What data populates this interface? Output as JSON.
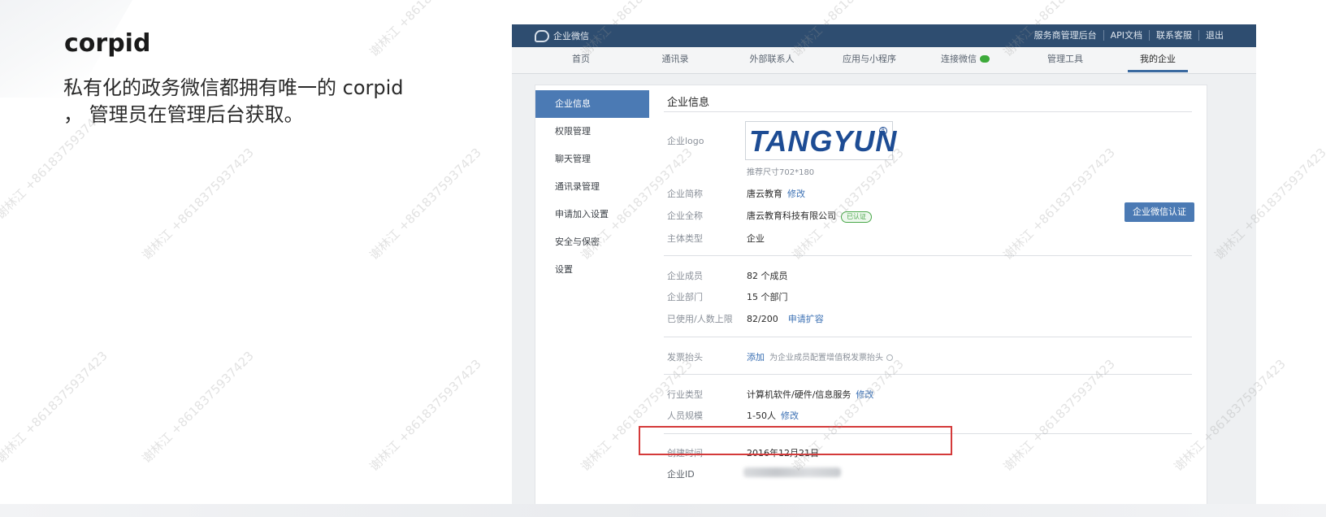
{
  "slide": {
    "title": "corpid",
    "description": "私有化的政务微信都拥有唯一的 corpid ， 管理员在管理后台获取。"
  },
  "screenshot": {
    "brand": "企业微信",
    "top_links": [
      "服务商管理后台",
      "API文档",
      "联系客服",
      "退出"
    ],
    "nav": [
      {
        "label": "首页",
        "active": false
      },
      {
        "label": "通讯录",
        "active": false
      },
      {
        "label": "外部联系人",
        "active": false
      },
      {
        "label": "应用与小程序",
        "active": false
      },
      {
        "label": "连接微信",
        "active": false
      },
      {
        "label": "管理工具",
        "active": false
      },
      {
        "label": "我的企业",
        "active": true
      }
    ],
    "sidebar": [
      {
        "label": "企业信息",
        "active": true
      },
      {
        "label": "权限管理",
        "active": false
      },
      {
        "label": "聊天管理",
        "active": false
      },
      {
        "label": "通讯录管理",
        "active": false
      },
      {
        "label": "申请加入设置",
        "active": false
      },
      {
        "label": "安全与保密",
        "active": false
      },
      {
        "label": "设置",
        "active": false
      }
    ],
    "content": {
      "title": "企业信息",
      "logo_label": "企业logo",
      "logo_text": "TANGYUN",
      "logo_hint": "推荐尺寸702*180",
      "short_name_label": "企业简称",
      "short_name": "唐云教育",
      "full_name_label": "企业全称",
      "full_name": "唐云教育科技有限公司",
      "verified": "已认证",
      "entity_type_label": "主体类型",
      "entity_type": "企业",
      "cert_button": "企业微信认证",
      "members_label": "企业成员",
      "members": "82 个成员",
      "departments_label": "企业部门",
      "departments": "15 个部门",
      "usage_label": "已使用/人数上限",
      "usage": "82/200",
      "expand_link": "申请扩容",
      "invoice_label": "发票抬头",
      "invoice_add": "添加",
      "invoice_hint": "为企业成员配置增值税发票抬头",
      "industry_label": "行业类型",
      "industry": "计算机软件/硬件/信息服务",
      "scale_label": "人员规模",
      "scale": "1-50人",
      "edit": "修改",
      "created_label": "创建时间",
      "created": "2016年12月21日",
      "corpid_label": "企业ID"
    }
  },
  "watermark": "谢林江 +8618375937423",
  "colors": {
    "topbar": "#2e4d70",
    "accent": "#4b7ab4",
    "highlight": "#d43a3a",
    "wechat_green": "#3daa3a"
  }
}
